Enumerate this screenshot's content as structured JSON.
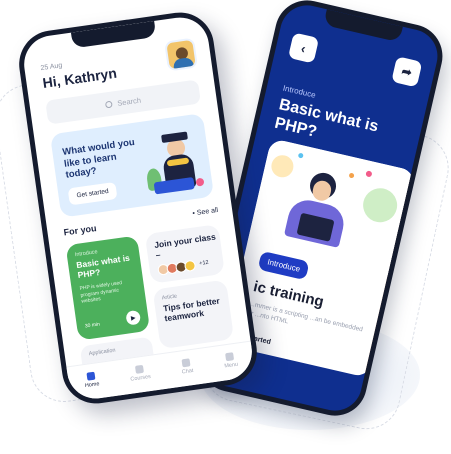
{
  "home": {
    "date": "25 Aug",
    "greeting": "Hi, Kathryn",
    "search_placeholder": "Search",
    "hero": {
      "title": "What would you like to learn today?",
      "button": "Get started"
    },
    "section_title": "For you",
    "see_all": "• See all",
    "cards": {
      "intro": {
        "kicker": "Introduce",
        "title": "Basic what is PHP?",
        "desc": "PHP is widely used program dynamic websites",
        "duration": "30 min"
      },
      "join": {
        "title": "Join your class –",
        "count": "+12"
      },
      "tips": {
        "kicker": "Article",
        "title": "Tips for better teamwork"
      },
      "application": {
        "kicker": "Application"
      }
    },
    "tabs": [
      {
        "label": "Home"
      },
      {
        "label": "Courses"
      },
      {
        "label": "Chat"
      },
      {
        "label": "Menu"
      }
    ]
  },
  "detail": {
    "kicker": "Introduce",
    "title": "Basic what is PHP?",
    "chip": "Introduce",
    "heading": "ic training",
    "body": "...mmer is a scripting ...an be embedded or ...nto HTML",
    "footer": "...started"
  },
  "colors": {
    "detail_bg": "#0f2f8f",
    "green_card": "#4cb05c",
    "hero_bg": "#dfeefe",
    "accent_orange": "#f4a24b"
  }
}
